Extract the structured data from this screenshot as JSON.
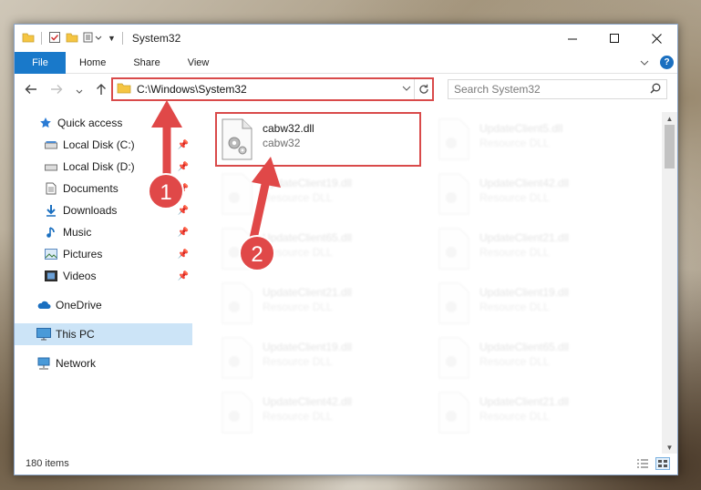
{
  "window": {
    "title": "System32"
  },
  "ribbon": {
    "tabs": [
      "File",
      "Home",
      "Share",
      "View"
    ],
    "help": "?"
  },
  "address": {
    "path": "C:\\Windows\\System32",
    "search_placeholder": "Search System32"
  },
  "sidebar": {
    "items": [
      {
        "label": "Quick access",
        "icon": "star-icon"
      },
      {
        "label": "Local Disk (C:)",
        "icon": "drive-icon",
        "pinned": true
      },
      {
        "label": "Local Disk (D:)",
        "icon": "drive-icon",
        "pinned": true
      },
      {
        "label": "Documents",
        "icon": "documents-icon",
        "pinned": true
      },
      {
        "label": "Downloads",
        "icon": "download-icon",
        "pinned": true
      },
      {
        "label": "Music",
        "icon": "music-icon",
        "pinned": true
      },
      {
        "label": "Pictures",
        "icon": "pictures-icon",
        "pinned": true
      },
      {
        "label": "Videos",
        "icon": "videos-icon",
        "pinned": true
      },
      {
        "label": "OneDrive",
        "icon": "cloud-icon"
      },
      {
        "label": "This PC",
        "icon": "computer-icon",
        "selected": true
      },
      {
        "label": "Network",
        "icon": "network-icon"
      }
    ]
  },
  "files": [
    {
      "name": "cabw32.dll",
      "type": "cabw32",
      "highlighted": true
    },
    {
      "name": "UpdateClient5.dll",
      "type": "Resource DLL"
    },
    {
      "name": "UpdateClient19.dll",
      "type": "Resource DLL"
    },
    {
      "name": "UpdateClient42.dll",
      "type": "Resource DLL"
    },
    {
      "name": "UpdateClient65.dll",
      "type": "Resource DLL"
    },
    {
      "name": "UpdateClient21.dll",
      "type": "Resource DLL"
    },
    {
      "name": "UpdateClient21.dll",
      "type": "Resource DLL"
    },
    {
      "name": "UpdateClient19.dll",
      "type": "Resource DLL"
    },
    {
      "name": "UpdateClient19.dll",
      "type": "Resource DLL"
    },
    {
      "name": "UpdateClient65.dll",
      "type": "Resource DLL"
    },
    {
      "name": "UpdateClient42.dll",
      "type": "Resource DLL"
    },
    {
      "name": "UpdateClient21.dll",
      "type": "Resource DLL"
    }
  ],
  "status": {
    "items_count": "180 items"
  },
  "annotations": {
    "step1": "1",
    "step2": "2",
    "color": "#e04848"
  }
}
